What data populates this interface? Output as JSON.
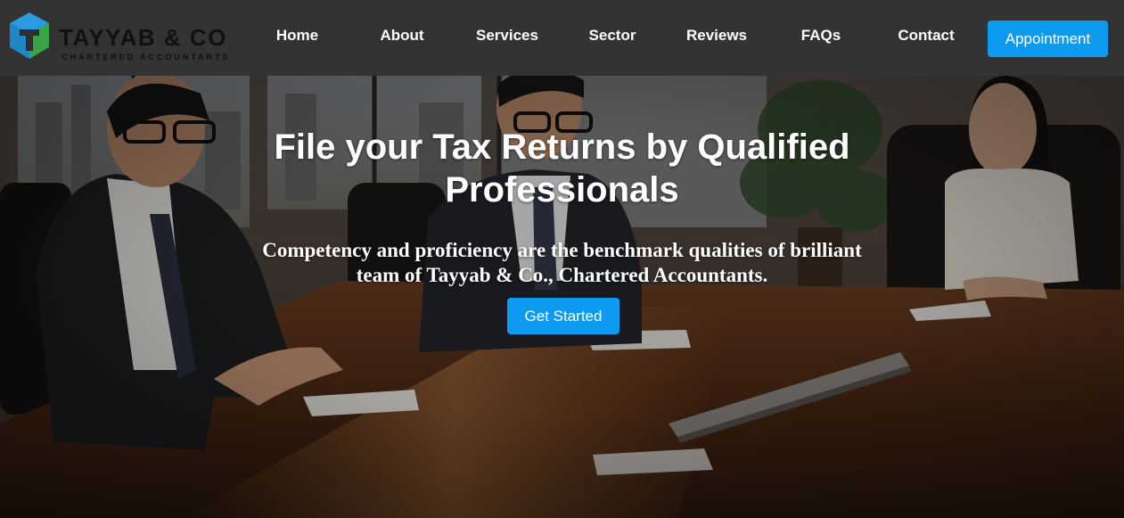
{
  "brand": {
    "name": "TAYYAB & CO",
    "subtitle": "CHARTERED ACCOUNTANTS",
    "logo_icon": "tc-cube-logo-icon",
    "colors": {
      "blue": "#1f86c8",
      "green": "#3aa345"
    }
  },
  "nav": {
    "items": [
      {
        "label": "Home"
      },
      {
        "label": "About"
      },
      {
        "label": "Services"
      },
      {
        "label": "Sector"
      },
      {
        "label": "Reviews"
      },
      {
        "label": "FAQs"
      },
      {
        "label": "Contact"
      }
    ],
    "cta_label": "Appointment"
  },
  "hero": {
    "title": "File your Tax Returns by Qualified Professionals",
    "subtitle": "Competency and proficiency are the benchmark qualities of brilliant team of Tayyab & Co., Chartered Accountants.",
    "cta_label": "Get Started",
    "background_image": "business-meeting-photo"
  },
  "colors": {
    "navbar_bg": "#333333",
    "accent": "#0d9bf2",
    "text_light": "#ffffff"
  }
}
